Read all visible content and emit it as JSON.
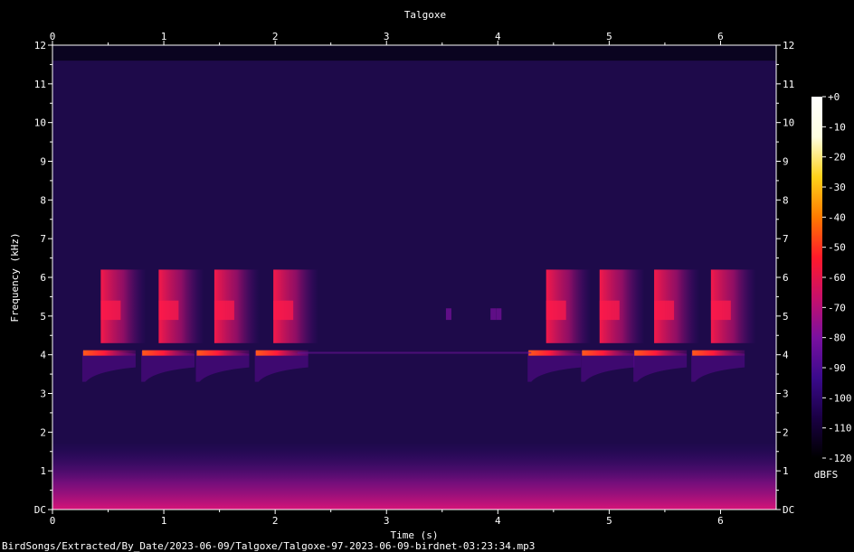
{
  "chart_data": {
    "type": "heatmap",
    "title": "Talgoxe",
    "xlabel": "Time (s)",
    "ylabel": "Frequency (kHz)",
    "xlim": [
      0,
      6.5
    ],
    "ylim": [
      0,
      12
    ],
    "x_ticks": [
      "0",
      "1",
      "2",
      "3",
      "4",
      "5",
      "6"
    ],
    "y_ticks": [
      "DC",
      "1",
      "2",
      "3",
      "4",
      "5",
      "6",
      "7",
      "8",
      "9",
      "10",
      "11",
      "12"
    ],
    "colorbar": {
      "label": "dBFS",
      "range": [
        -120,
        0
      ],
      "ticks": [
        "+0",
        "-10",
        "-20",
        "-30",
        "-40",
        "-50",
        "-60",
        "-70",
        "-80",
        "-90",
        "-100",
        "-110",
        "-120"
      ],
      "stops": [
        "#000000",
        "#1a0044",
        "#3a0a8c",
        "#7a10a0",
        "#c8106a",
        "#ff1a2a",
        "#ff7a00",
        "#ffd21a",
        "#ffffe0",
        "#ffffff"
      ]
    },
    "background_color": "#1e0a4a",
    "noise_ceiling_khz": 11.6,
    "calls": {
      "tone_khz": 4.0,
      "tone_times_s": [
        0.3,
        0.83,
        1.32,
        1.85,
        4.3,
        4.78,
        5.25,
        5.77
      ],
      "sweep_khz": [
        4.3,
        6.2
      ],
      "sweep_times_s": [
        0.45,
        0.97,
        1.47,
        2.0,
        4.45,
        4.93,
        5.42,
        5.93
      ],
      "faint_times_s": [
        3.55,
        3.95,
        4.0
      ]
    },
    "footer": "BirdSongs/Extracted/By_Date/2023-06-09/Talgoxe/Talgoxe-97-2023-06-09-birdnet-03:23:34.mp3"
  }
}
